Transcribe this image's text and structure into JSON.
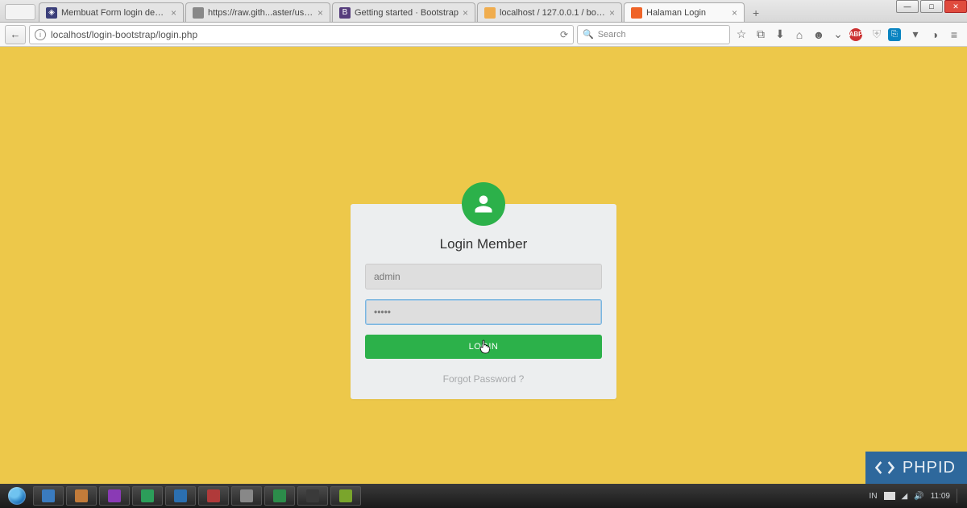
{
  "window_controls": {
    "min": "—",
    "max": "□",
    "close": "✕"
  },
  "tabs": [
    {
      "label": "Membuat Form login deng...",
      "favicon_bg": "#3b3f7a",
      "favicon_txt": "◈"
    },
    {
      "label": "https://raw.gith...aster/users.sql",
      "favicon_bg": "#888",
      "favicon_txt": ""
    },
    {
      "label": "Getting started · Bootstrap",
      "favicon_bg": "#563d7c",
      "favicon_txt": "B"
    },
    {
      "label": "localhost / 127.0.0.1 / boot...",
      "favicon_bg": "#f0ad4e",
      "favicon_txt": ""
    },
    {
      "label": "Halaman Login",
      "favicon_bg": "#ef6428",
      "favicon_txt": "",
      "active": true
    }
  ],
  "new_tab": "+",
  "nav": {
    "back": "←"
  },
  "url": "localhost/login-bootstrap/login.php",
  "reload": "⟳",
  "search_placeholder": "Search",
  "toolbar_icons": {
    "star": "☆",
    "reader": "⧉",
    "download": "⬇",
    "home": "⌂",
    "smile": "☻",
    "pocket": "⌄",
    "abp": "ABP",
    "shield": "⛨",
    "onetab": "⎘",
    "more": "▾",
    "dev": "◑",
    "menu": "≡"
  },
  "login": {
    "title": "Login Member",
    "username_value": "admin",
    "password_value": "•••••",
    "button": "LOGIN",
    "forgot": "Forgot Password ?"
  },
  "watermark": "PHPID",
  "taskbar": {
    "items_count": 10,
    "lang": "IN",
    "time": "11:09"
  }
}
